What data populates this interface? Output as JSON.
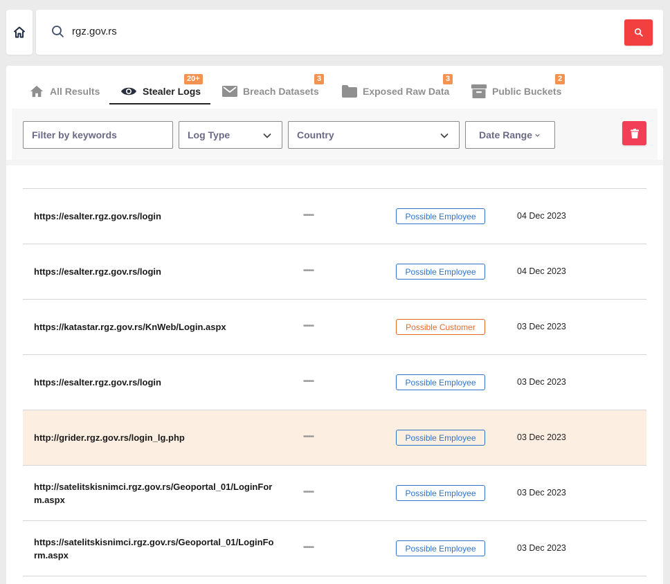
{
  "search": {
    "query": "rgz.gov.rs"
  },
  "tabs": [
    {
      "label": "All Results",
      "icon": "home-icon",
      "badge": ""
    },
    {
      "label": "Stealer Logs",
      "icon": "eye-icon",
      "badge": "20+"
    },
    {
      "label": "Breach Datasets",
      "icon": "mail-icon",
      "badge": "3"
    },
    {
      "label": "Exposed Raw Data",
      "icon": "folder-icon",
      "badge": "3"
    },
    {
      "label": "Public Buckets",
      "icon": "archive-icon",
      "badge": "2"
    }
  ],
  "filters": {
    "keywords_placeholder": "Filter by keywords",
    "log_type": "Log Type",
    "country": "Country",
    "date_range": "Date Range"
  },
  "rows": [
    {
      "url": "https://esalter.rgz.gov.rs/login",
      "password": "••••••",
      "tag": "Possible Employee",
      "date": "04 Dec 2023"
    },
    {
      "url": "https://esalter.rgz.gov.rs/login",
      "password": "••••••",
      "tag": "Possible Employee",
      "date": "04 Dec 2023"
    },
    {
      "url": "https://katastar.rgz.gov.rs/KnWeb/Login.aspx",
      "password": "••••••",
      "tag": "Possible Customer",
      "date": "03 Dec 2023"
    },
    {
      "url": "https://esalter.rgz.gov.rs/login",
      "password": "••••••",
      "tag": "Possible Employee",
      "date": "03 Dec 2023"
    },
    {
      "url": "http://grider.rgz.gov.rs/login_lg.php",
      "password": "••••••",
      "tag": "Possible Employee",
      "date": "03 Dec 2023"
    },
    {
      "url": "http://satelitskisnimci.rgz.gov.rs/Geoportal_01/LoginForm.aspx",
      "password": "••••••",
      "tag": "Possible Employee",
      "date": "03 Dec 2023"
    },
    {
      "url": "https://satelitskisnimci.rgz.gov.rs/Geoportal_01/LoginForm.aspx",
      "password": "••••••",
      "tag": "Possible Employee",
      "date": "03 Dec 2023"
    }
  ],
  "colors": {
    "accent_red": "#f23f3f",
    "badge_orange": "#f39251",
    "employee_blue": "#2c73c9",
    "customer_orange": "#e86a28",
    "highlight_row": "#fdeee2"
  }
}
